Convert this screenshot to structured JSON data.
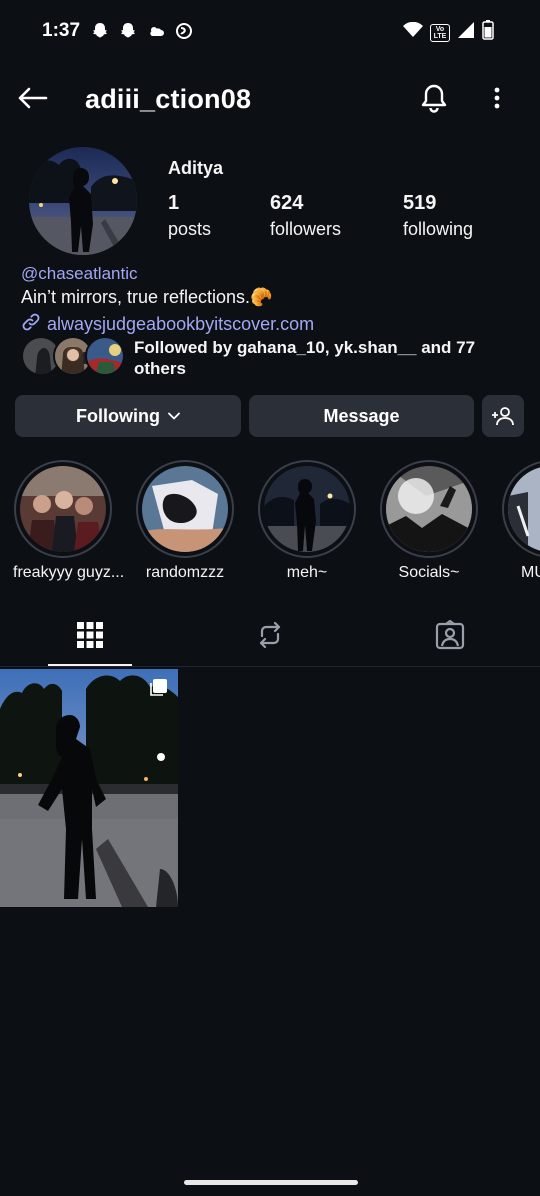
{
  "status_bar": {
    "time": "1:37",
    "left_icons": [
      "snapchat-icon",
      "snapchat-icon",
      "weather-icon",
      "app-icon"
    ],
    "right_icons": [
      "wifi-icon",
      "volte-icon",
      "signal-icon",
      "battery-icon"
    ],
    "volte_label": "Vo LTE"
  },
  "header": {
    "username": "adiii_ction08"
  },
  "profile": {
    "display_name": "Aditya",
    "stats": [
      {
        "value": "1",
        "label": "posts"
      },
      {
        "value": "624",
        "label": "followers"
      },
      {
        "value": "519",
        "label": "following"
      }
    ],
    "bio_mention": "@chaseatlantic",
    "bio_text": "Ain’t mirrors, true reflections.🥐",
    "bio_link": "alwaysjudgeabookbyitscover.com",
    "followed_by": "Followed by gahana_10, yk.shan__ and 77 others"
  },
  "actions": {
    "following_label": "Following",
    "message_label": "Message"
  },
  "highlights": [
    {
      "label": "freakyyy guyz..."
    },
    {
      "label": "randomzzz"
    },
    {
      "label": "meh~"
    },
    {
      "label": "Socials~"
    },
    {
      "label": "MU"
    }
  ],
  "tabs": [
    {
      "name": "grid",
      "icon": "grid-icon"
    },
    {
      "name": "reposts",
      "icon": "repost-icon"
    },
    {
      "name": "tagged",
      "icon": "tagged-icon"
    }
  ],
  "colors": {
    "background": "#0c0f14",
    "button": "#2b2f38",
    "link": "#a3a8f5"
  }
}
